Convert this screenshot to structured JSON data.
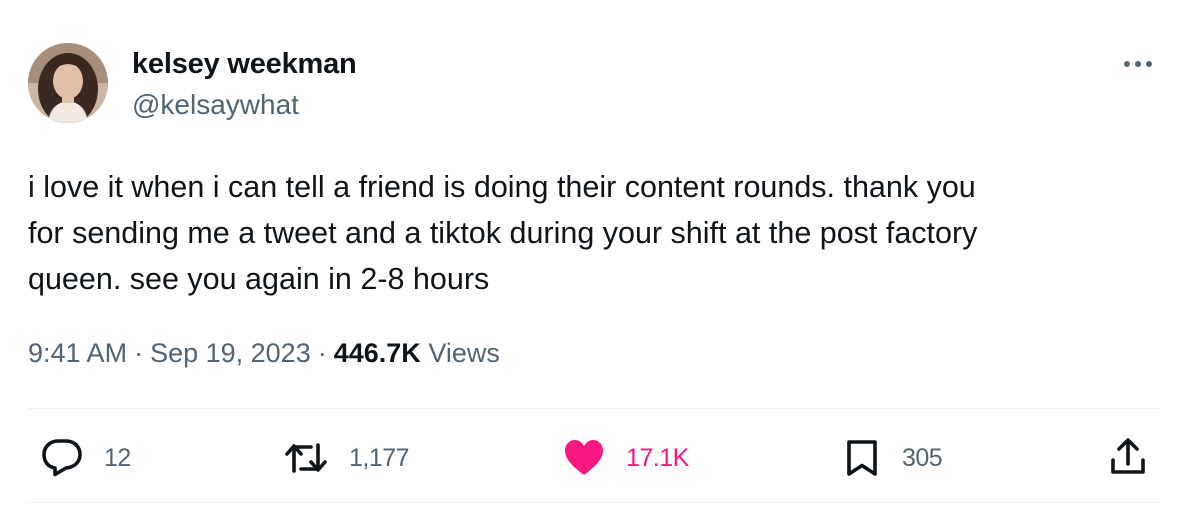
{
  "author": {
    "name": "kelsey weekman",
    "handle": "@kelsaywhat"
  },
  "tweet": {
    "lines": [
      "i love it when i can tell a friend is doing their content rounds. thank you",
      "for sending me a tweet and a tiktok during your shift at the post factory",
      "queen. see you again in 2-8 hours"
    ]
  },
  "meta": {
    "time": "9:41 AM",
    "separator": "·",
    "date": "Sep 19, 2023",
    "views_count": "446.7K",
    "views_label": "Views"
  },
  "actions": {
    "replies": "12",
    "retweets": "1,177",
    "likes": "17.1K",
    "bookmarks": "305"
  },
  "icons": {
    "more": "more-icon",
    "reply": "reply-icon",
    "retweet": "retweet-icon",
    "like": "heart-icon",
    "bookmark": "bookmark-icon",
    "share": "share-icon"
  },
  "colors": {
    "text": "#0f1419",
    "secondary": "#536471",
    "like": "#f91880",
    "divider": "#eff3f4"
  }
}
